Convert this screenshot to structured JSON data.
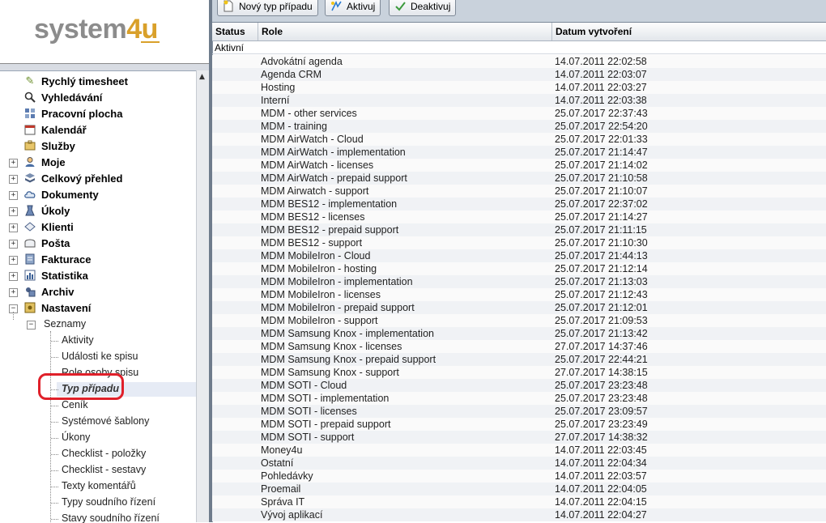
{
  "app": {
    "logo_part1": "system",
    "logo_part2": "4u"
  },
  "toolbar": {
    "buttons": [
      {
        "label": "Nový typ případu",
        "icon": "new-document-icon"
      },
      {
        "label": "Aktivuj",
        "icon": "activate-icon"
      },
      {
        "label": "Deaktivuj",
        "icon": "deactivate-icon"
      }
    ]
  },
  "nav": {
    "items": [
      {
        "label": "Rychlý timesheet",
        "icon": "timesheet-icon"
      },
      {
        "label": "Vyhledávání",
        "icon": "search-icon"
      },
      {
        "label": "Pracovní plocha",
        "icon": "desktop-icon"
      },
      {
        "label": "Kalendář",
        "icon": "calendar-icon"
      },
      {
        "label": "Služby",
        "icon": "services-icon"
      },
      {
        "label": "Moje",
        "icon": "user-icon"
      },
      {
        "label": "Celkový přehled",
        "icon": "overview-icon"
      },
      {
        "label": "Dokumenty",
        "icon": "cloud-icon"
      },
      {
        "label": "Úkoly",
        "icon": "tasks-icon"
      },
      {
        "label": "Klienti",
        "icon": "clients-icon"
      },
      {
        "label": "Pošta",
        "icon": "mail-icon"
      },
      {
        "label": "Fakturace",
        "icon": "invoice-icon"
      },
      {
        "label": "Statistika",
        "icon": "chart-icon"
      },
      {
        "label": "Archiv",
        "icon": "archive-icon"
      },
      {
        "label": "Nastavení",
        "icon": "settings-icon"
      }
    ],
    "settings_group": "Seznamy",
    "settings_items": [
      "Aktivity",
      "Události ke spisu",
      "Role osoby spisu",
      "Typ případu",
      "Ceník",
      "Systémové šablony",
      "Úkony",
      "Checklist - položky",
      "Checklist - sestavy",
      "Texty komentářů",
      "Typy soudního řízení",
      "Stavy soudního řízení"
    ],
    "selected": "Typ případu"
  },
  "grid": {
    "columns": [
      "Status",
      "Role",
      "Datum vytvoření"
    ],
    "group_label": "Aktivní",
    "rows": [
      {
        "role": "Advokátní agenda",
        "date": "14.07.2011 22:02:58"
      },
      {
        "role": "Agenda CRM",
        "date": "14.07.2011 22:03:07"
      },
      {
        "role": "Hosting",
        "date": "14.07.2011 22:03:27"
      },
      {
        "role": "Interní",
        "date": "14.07.2011 22:03:38"
      },
      {
        "role": "MDM - other services",
        "date": "25.07.2017 22:37:43"
      },
      {
        "role": "MDM - training",
        "date": "25.07.2017 22:54:20"
      },
      {
        "role": "MDM AirWatch - Cloud",
        "date": "25.07.2017 22:01:33"
      },
      {
        "role": "MDM AirWatch - implementation",
        "date": "25.07.2017 21:14:47"
      },
      {
        "role": "MDM AirWatch - licenses",
        "date": "25.07.2017 21:14:02"
      },
      {
        "role": "MDM AirWatch - prepaid support",
        "date": "25.07.2017 21:10:58"
      },
      {
        "role": "MDM Airwatch - support",
        "date": "25.07.2017 21:10:07"
      },
      {
        "role": "MDM BES12 - implementation",
        "date": "25.07.2017 22:37:02"
      },
      {
        "role": "MDM BES12 - licenses",
        "date": "25.07.2017 21:14:27"
      },
      {
        "role": "MDM BES12 - prepaid support",
        "date": "25.07.2017 21:11:15"
      },
      {
        "role": "MDM BES12 - support",
        "date": "25.07.2017 21:10:30"
      },
      {
        "role": "MDM MobileIron - Cloud",
        "date": "25.07.2017 21:44:13"
      },
      {
        "role": "MDM MobileIron - hosting",
        "date": "25.07.2017 21:12:14"
      },
      {
        "role": "MDM MobileIron - implementation",
        "date": "25.07.2017 21:13:03"
      },
      {
        "role": "MDM MobileIron - licenses",
        "date": "25.07.2017 21:12:43"
      },
      {
        "role": "MDM MobileIron - prepaid support",
        "date": "25.07.2017 21:12:01"
      },
      {
        "role": "MDM MobileIron - support",
        "date": "25.07.2017 21:09:53"
      },
      {
        "role": "MDM Samsung Knox - implementation",
        "date": "25.07.2017 21:13:42"
      },
      {
        "role": "MDM Samsung Knox - licenses",
        "date": "27.07.2017 14:37:46"
      },
      {
        "role": "MDM Samsung Knox - prepaid support",
        "date": "25.07.2017 22:44:21"
      },
      {
        "role": "MDM Samsung Knox - support",
        "date": "27.07.2017 14:38:15"
      },
      {
        "role": "MDM SOTI - Cloud",
        "date": "25.07.2017 23:23:48"
      },
      {
        "role": "MDM SOTI - implementation",
        "date": "25.07.2017 23:23:48"
      },
      {
        "role": "MDM SOTI - licenses",
        "date": "25.07.2017 23:09:57"
      },
      {
        "role": "MDM SOTI - prepaid support",
        "date": "25.07.2017 23:23:49"
      },
      {
        "role": "MDM SOTI - support",
        "date": "27.07.2017 14:38:32"
      },
      {
        "role": "Money4u",
        "date": "14.07.2011 22:03:45"
      },
      {
        "role": "Ostatní",
        "date": "14.07.2011 22:04:34"
      },
      {
        "role": "Pohledávky",
        "date": "14.07.2011 22:03:57"
      },
      {
        "role": "Proemail",
        "date": "14.07.2011 22:04:05"
      },
      {
        "role": "Správa IT",
        "date": "14.07.2011 22:04:15"
      },
      {
        "role": "Vývoj aplikací",
        "date": "14.07.2011 22:04:27"
      }
    ]
  }
}
